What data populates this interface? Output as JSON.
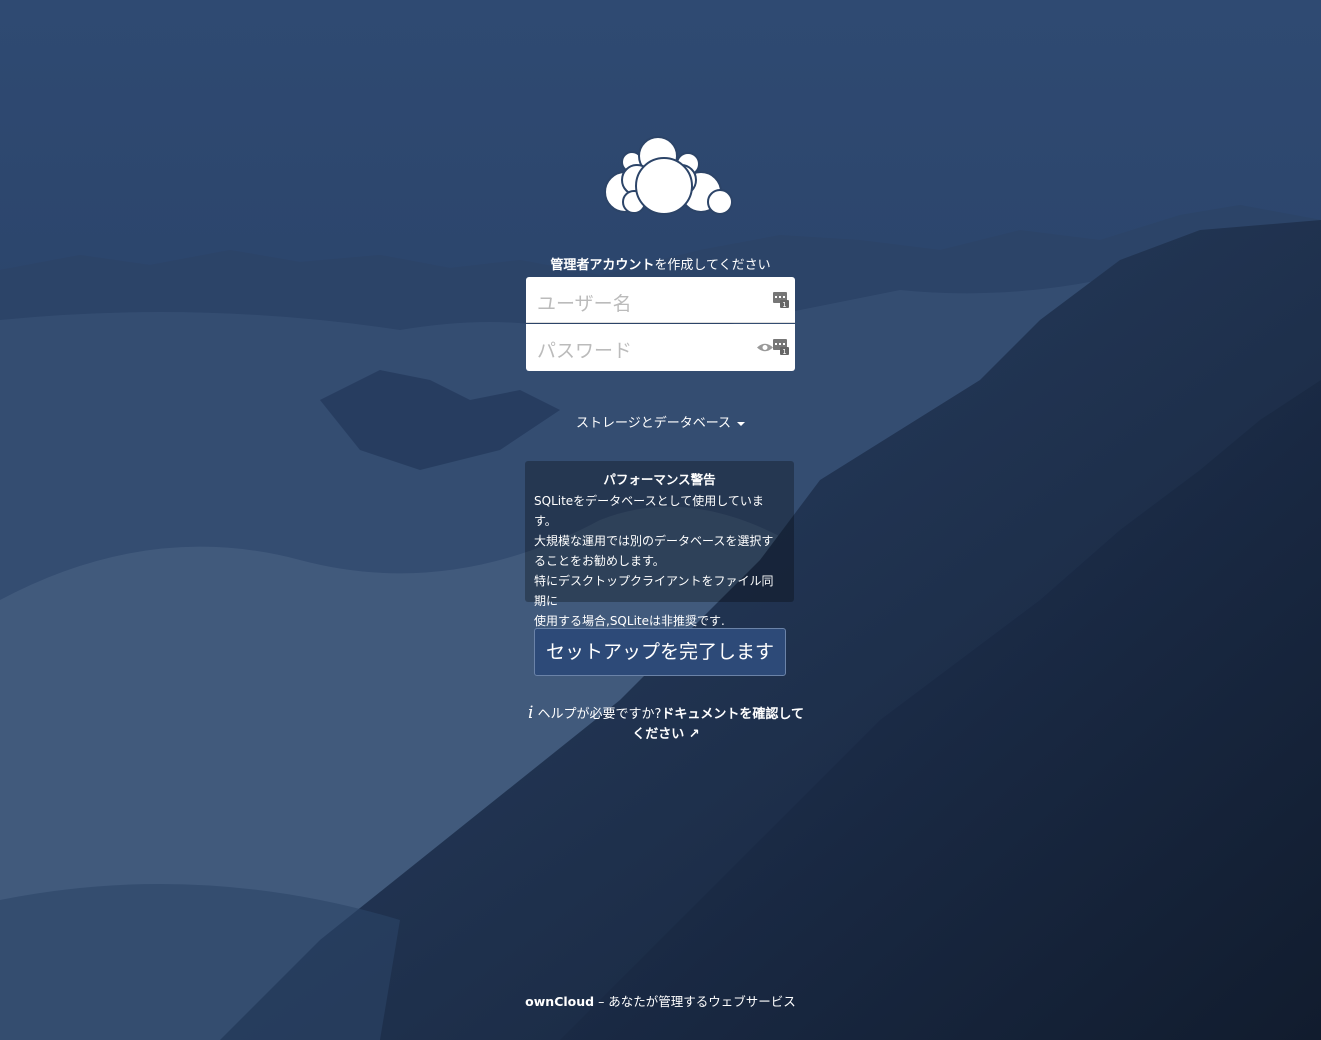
{
  "header": {
    "title_bold": "管理者アカウント",
    "title_rest": "を作成してください"
  },
  "form": {
    "username_placeholder": "ユーザー名",
    "password_placeholder": "パスワード"
  },
  "storage": {
    "label": "ストレージとデータベース"
  },
  "warning": {
    "title": "パフォーマンス警告",
    "lines": [
      "SQLiteをデータベースとして使用しています。",
      "大規模な運用では別のデータベースを選択す",
      "ることをお勧めします。",
      "特にデスクトップクライアントをファイル同期に",
      "使用する場合,SQLiteは非推奨です."
    ]
  },
  "submit": {
    "label": "セットアップを完了します"
  },
  "help": {
    "icon": "info-icon",
    "text": "ヘルプが必要ですか?",
    "link": "ドキュメントを確認してください ↗"
  },
  "footer": {
    "brand": "ownCloud",
    "tagline": " – あなたが管理するウェブサービス"
  },
  "colors": {
    "background": "#1f3253",
    "button": "#2d4a78"
  }
}
